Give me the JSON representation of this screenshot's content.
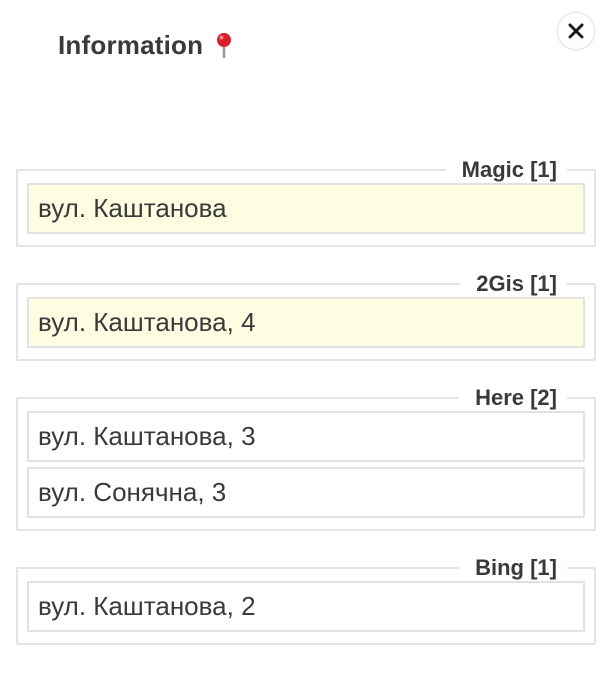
{
  "header": {
    "title": "Information",
    "pin_icon": "map-pin-icon",
    "close_icon": "close-icon"
  },
  "colors": {
    "highlight_background": "#fdfde1",
    "pin_red": "#d8202a"
  },
  "groups": [
    {
      "name": "Magic",
      "count_label": "Magic [1]",
      "items": [
        {
          "text": "вул. Каштанова",
          "highlighted": true
        }
      ]
    },
    {
      "name": "2Gis",
      "count_label": "2Gis [1]",
      "items": [
        {
          "text": "вул. Каштанова, 4",
          "highlighted": true
        }
      ]
    },
    {
      "name": "Here",
      "count_label": "Here [2]",
      "items": [
        {
          "text": "вул. Каштанова, 3",
          "highlighted": false
        },
        {
          "text": "вул. Сонячна, 3",
          "highlighted": false
        }
      ]
    },
    {
      "name": "Bing",
      "count_label": "Bing [1]",
      "items": [
        {
          "text": "вул. Каштанова, 2",
          "highlighted": false
        }
      ]
    }
  ]
}
